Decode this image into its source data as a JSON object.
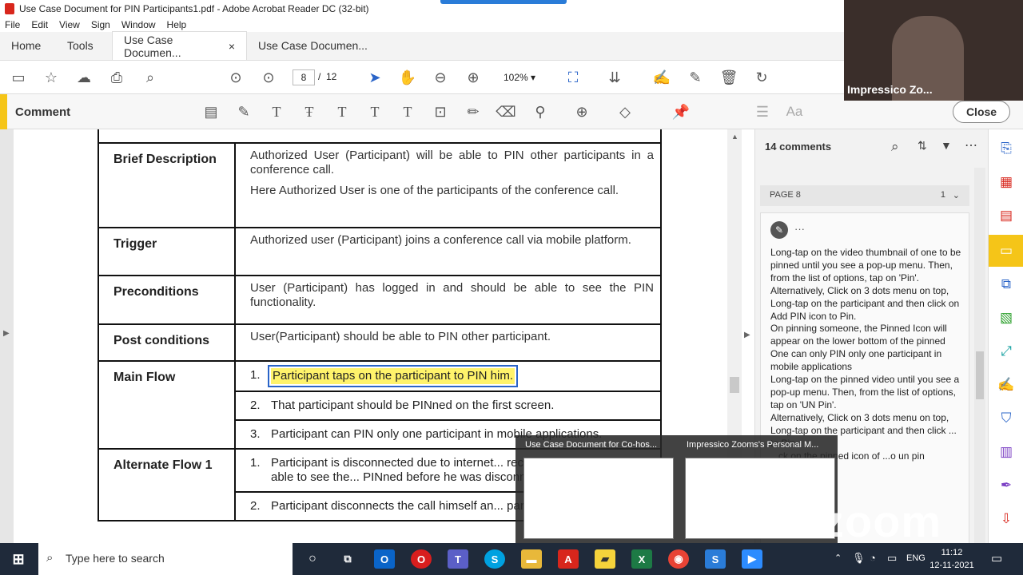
{
  "window": {
    "title": "Use Case Document for PIN Participants1.pdf - Adobe Acrobat Reader DC (32-bit)"
  },
  "menu": [
    "File",
    "Edit",
    "View",
    "Sign",
    "Window",
    "Help"
  ],
  "tabs": {
    "home": "Home",
    "tools": "Tools",
    "doc1": "Use Case Documen...",
    "doc2": "Use Case Documen...",
    "close": "×"
  },
  "toolbar": {
    "page_current": "8",
    "page_sep": "/",
    "page_total": "12",
    "zoom": "102%"
  },
  "commentbar": {
    "label": "Comment",
    "close": "Close",
    "aa": "Aa"
  },
  "doc": {
    "rows": [
      {
        "label": "Brief Description",
        "p1": "Authorized User (Participant) will be able to PIN other participants in a conference call.",
        "p2": "Here Authorized User is one of the participants of the conference call."
      },
      {
        "label": "Trigger",
        "p1": "Authorized user (Participant) joins a conference call via mobile platform."
      },
      {
        "label": "Preconditions",
        "p1": "User (Participant) has logged in and should be able to see the PIN functionality."
      },
      {
        "label": "Post conditions",
        "p1": "User(Participant) should be able to PIN other participant."
      }
    ],
    "main_flow": {
      "label": "Main Flow",
      "items": [
        {
          "n": "1.",
          "text": "Participant taps on the participant to PIN him."
        },
        {
          "n": "2.",
          "text": "That participant should be PINned  on the first screen."
        },
        {
          "n": "3.",
          "text": "Participant can PIN only one participant in mobile applications."
        }
      ]
    },
    "alt_flow": {
      "label": "Alternate Flow 1",
      "items": [
        {
          "n": "1.",
          "text": "Participant is disconnected due to internet... reconnects, he should be able to see the... PINned before he was disconnected)."
        },
        {
          "n": "2.",
          "text": "Participant disconnects the call himself an... participant should be there."
        }
      ]
    }
  },
  "comments": {
    "count_label": "14 comments",
    "page_label": "PAGE 8",
    "page_count": "1",
    "menu": "···",
    "text": "Long-tap on the video thumbnail of one to be pinned until you see a pop-up menu. Then, from the list of options, tap on 'Pin'.\nAlternatively, Click on 3 dots menu on top, Long-tap on the participant and then click on Add PIN icon to Pin.\nOn pinning someone, the Pinned Icon will appear on the lower bottom of the pinned\nOne can only PIN only one participant in mobile applications\nLong-tap on the pinned video until you see a pop-up menu. Then, from the list of options, tap on 'UN Pin'.\nAlternatively,  Click on 3 dots menu on top, Long-tap on the participant and then click ... to Pin.\n...ck on the pinned icon of ...o un pin"
  },
  "zoom": {
    "webcam_name": "Impressico Zo...",
    "thumb1_title": "Use Case Document for Co-hos...",
    "thumb2_title": "Impressico Zooms's Personal M...",
    "watermark": "zoom"
  },
  "taskbar": {
    "search_placeholder": "Type here to search",
    "lang": "ENG",
    "time": "11:12",
    "date": "12-11-2021"
  }
}
